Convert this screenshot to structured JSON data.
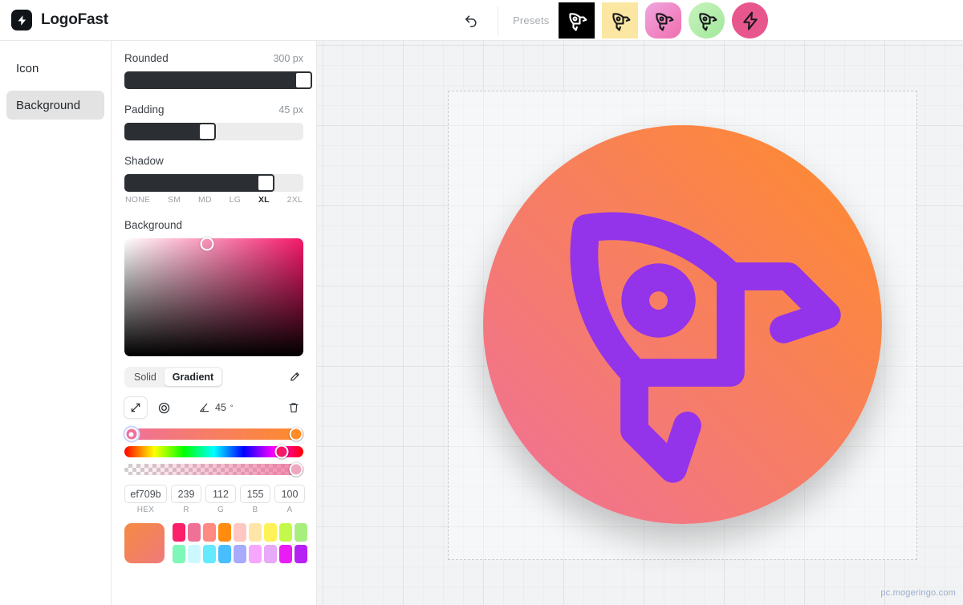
{
  "header": {
    "brand": "LogoFast",
    "brand_icon": "bolt-icon",
    "undo_icon": "undo-arrow-icon",
    "presets_label": "Presets",
    "presets": [
      {
        "name": "preset-black-rocket",
        "icon": "rocket-icon",
        "bg": "#000000",
        "stroke": "#ffffff",
        "radius": "0px"
      },
      {
        "name": "preset-cream-rocket",
        "icon": "rocket-icon",
        "bg": "#fbe7a2",
        "stroke": "#18181b",
        "radius": "0px"
      },
      {
        "name": "preset-pink-rocket",
        "icon": "rocket-icon",
        "bg": "linear-gradient(135deg,#f0a6e0 0%,#ef6fae 100%)",
        "stroke": "#18181b",
        "radius": "14px"
      },
      {
        "name": "preset-green-rocket",
        "icon": "rocket-icon",
        "bg": "linear-gradient(135deg,#c7f3bd 0%,#a2e89a 100%)",
        "stroke": "#18181b",
        "radius": "50%"
      },
      {
        "name": "preset-pink-bolt",
        "icon": "bolt-icon",
        "bg": "#e8568e",
        "stroke": "#18181b",
        "radius": "50%"
      }
    ]
  },
  "sidebar": {
    "items": [
      {
        "label": "Icon",
        "name": "sidebar-item-icon",
        "active": false
      },
      {
        "label": "Background",
        "name": "sidebar-item-background",
        "active": true
      }
    ]
  },
  "panel": {
    "rounded": {
      "label": "Rounded",
      "value": "300 px",
      "percent": 100
    },
    "padding": {
      "label": "Padding",
      "value": "45 px",
      "percent": 45
    },
    "shadow": {
      "label": "Shadow",
      "percent": 78,
      "ticks": [
        "NONE",
        "SM",
        "MD",
        "LG",
        "XL",
        "2XL"
      ],
      "selected": "XL"
    },
    "background": {
      "label": "Background",
      "picker": {
        "hue_color": "#f5186a",
        "cursor_x_pct": 46,
        "cursor_y_pct": 5
      },
      "mode": {
        "solid": "Solid",
        "gradient": "Gradient",
        "selected": "Gradient"
      },
      "eyedropper_icon": "eyedropper-icon",
      "gradient_controls": {
        "linear_icon": "linear-gradient-icon",
        "radial_icon": "radial-gradient-icon",
        "selected_type": "linear",
        "angle_icon": "angle-icon",
        "angle_value": "45",
        "angle_unit": "°",
        "delete_icon": "trash-icon"
      },
      "gradient_stops": [
        {
          "name": "gradient-stop-start",
          "color": "#ef709b",
          "position_pct": 4,
          "selected": true
        },
        {
          "name": "gradient-stop-end",
          "color": "#ff8c29",
          "position_pct": 96,
          "selected": false
        }
      ],
      "hue_slider": {
        "handle_pct": 88,
        "handle_color": "#f5186a"
      },
      "alpha_slider": {
        "handle_pct": 96,
        "handle_color": "#f0a7c0"
      },
      "fields": [
        {
          "name": "hex-field",
          "label": "HEX",
          "value": "ef709b",
          "kind": "hex"
        },
        {
          "name": "red-field",
          "label": "R",
          "value": "239",
          "kind": "num"
        },
        {
          "name": "green-field",
          "label": "G",
          "value": "112",
          "kind": "num"
        },
        {
          "name": "blue-field",
          "label": "B",
          "value": "155",
          "kind": "num"
        },
        {
          "name": "alpha-field",
          "label": "A",
          "value": "100",
          "kind": "num"
        }
      ],
      "preview_swatch": "linear-gradient(135deg,#f58a42 0%,#ef7a7a 100%)",
      "swatches": [
        [
          "#fc1f69",
          "#ef7196",
          "#ff8a82",
          "#ff8c0f",
          "#ffc7c2",
          "#ffe6a8",
          "#fff258",
          "#c3f94a",
          "#a7ee7f"
        ],
        [
          "#7ef7b9",
          "#ccf9ff",
          "#63eaff",
          "#47befe",
          "#a8abfb",
          "#f6a7fd",
          "#e8a9f7",
          "#e91cf5",
          "#b522f3"
        ]
      ]
    }
  },
  "canvas": {
    "logo": {
      "name": "logo-preview",
      "icon": "rocket-icon",
      "icon_color": "#9333ea",
      "background": "linear-gradient(45deg,#ef709b 0%,#ff8c29 100%)",
      "border_radius": "300px"
    },
    "watermark": "pc.mogeringo.com"
  }
}
